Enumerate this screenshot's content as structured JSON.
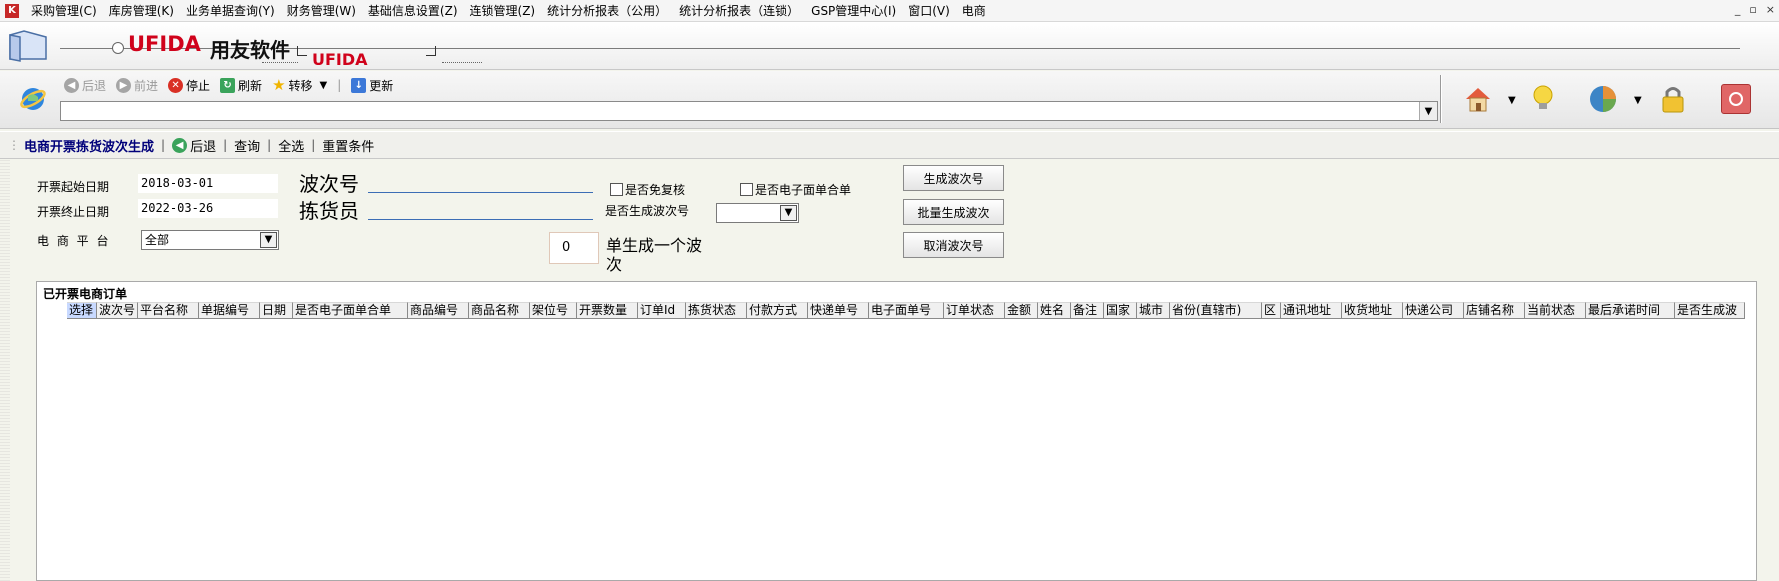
{
  "menubar": {
    "items": [
      "采购管理(C)",
      "库房管理(K)",
      "业务单据查询(Y)",
      "财务管理(W)",
      "基础信息设置(Z)",
      "连锁管理(Z)",
      "统计分析报表（公用）",
      "统计分析报表（连锁）",
      "GSP管理中心(I)",
      "窗口(V)",
      "电商"
    ],
    "window_controls": [
      "_",
      "▫",
      "×"
    ]
  },
  "banner": {
    "brand": "UFIDA",
    "brand_cn": "用友软件",
    "brand_sub": "UFIDA"
  },
  "browser_toolbar": {
    "back": "后退",
    "forward": "前进",
    "stop": "停止",
    "refresh": "刷新",
    "transfer": "转移",
    "update": "更新",
    "address": ""
  },
  "function_bar": {
    "title": "电商开票拣货波次生成",
    "back": "后退",
    "query": "查询",
    "select_all": "全选",
    "reset": "重置条件"
  },
  "form": {
    "start_date_label": "开票起始日期",
    "start_date": "2018-03-01",
    "end_date_label": "开票终止日期",
    "end_date": "2022-03-26",
    "platform_label": "电 商 平 台",
    "platform_value": "全部",
    "wave_no_label": "波次号",
    "picker_label": "拣货员",
    "exempt_review": "是否免复核",
    "e_waybill_merge": "是否电子面单合单",
    "generated_wave_label": "是否生成波次号",
    "generated_wave_value": "",
    "per_wave_count": "0",
    "per_wave_suffix": "单生成一个波次",
    "btn_generate": "生成波次号",
    "btn_batch": "批量生成波次",
    "btn_cancel": "取消波次号"
  },
  "grid": {
    "caption": "已开票电商订单",
    "columns": [
      "选择",
      "波次号",
      "平台名称",
      "单据编号",
      "日期",
      "是否电子面单合单",
      "商品编号",
      "商品名称",
      "架位号",
      "开票数量",
      "订单Id",
      "拣货状态",
      "付款方式",
      "快递单号",
      "电子面单号",
      "订单状态",
      "金额",
      "姓名",
      "备注",
      "国家",
      "城市",
      "省份(直辖市)",
      "区",
      "通讯地址",
      "收货地址",
      "快递公司",
      "店铺名称",
      "当前状态",
      "最后承诺时间",
      "是否生成波"
    ],
    "rows": []
  }
}
